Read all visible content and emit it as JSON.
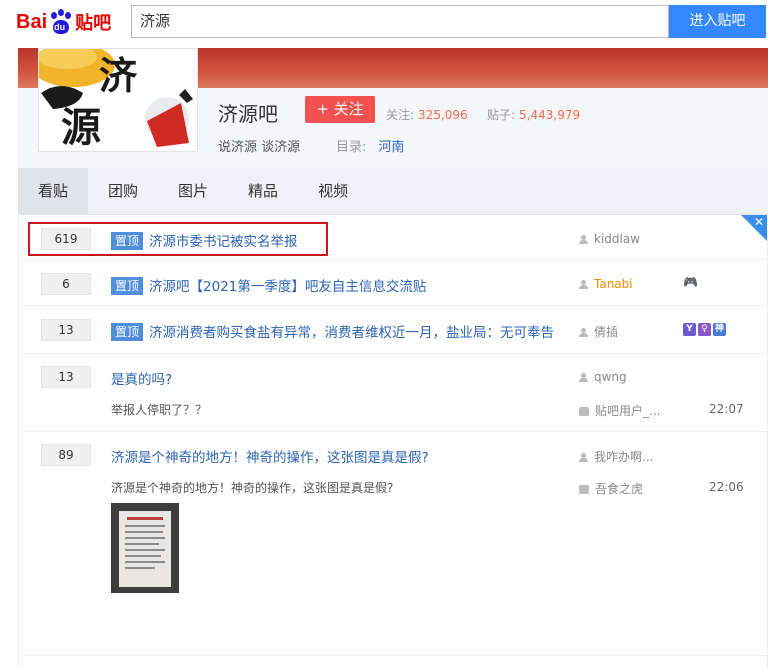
{
  "search": {
    "logo_bai": "Bai",
    "logo_du": "du",
    "logo_tieba": "贴吧",
    "query": "济源",
    "button_label": "进入贴吧"
  },
  "forum": {
    "name": "济源吧",
    "follow_label": "+ 关注",
    "follow_count_label": "关注:",
    "follow_count": "325,096",
    "post_count_label": "贴子:",
    "post_count": "5,443,979",
    "slogan": "说济源 谈济源",
    "catalog_label": "目录:",
    "catalog_value": "河南",
    "avatar_chars": [
      "济",
      "源"
    ]
  },
  "tabs": [
    "看贴",
    "团购",
    "图片",
    "精品",
    "视频"
  ],
  "close_glyph": "✕",
  "threads": [
    {
      "count": "619",
      "pinned": "置顶",
      "title": "济源市委书记被实名举报",
      "author": "kiddlaw"
    },
    {
      "count": "6",
      "pinned": "置顶",
      "title": "济源吧【2021第一季度】吧友自主信息交流贴",
      "author": "Tanabi",
      "author_badge": "🎮"
    },
    {
      "count": "13",
      "pinned": "置顶",
      "title": "济源消费者购买食盐有异常，消费者维权近一月，盐业局：无可奉告",
      "author": "倩插",
      "badges": [
        "Y",
        "♀",
        "神"
      ]
    },
    {
      "count": "13",
      "title": "是真的吗?",
      "author": "qwng",
      "abstract": "举报人停职了？？",
      "reply_author": "贴吧用户_...",
      "time": "22:07"
    },
    {
      "count": "89",
      "title": "济源是个神奇的地方！神奇的操作，这张图是真是假?",
      "author": "我咋办啊...",
      "abstract": "济源是个神奇的地方！神奇的操作，这张图是真是假?",
      "reply_author": "吾食之虎",
      "time": "22:06"
    }
  ],
  "colors": {
    "brand_red": "#e10602",
    "brand_blue": "#2319dc",
    "link_blue": "#2d64b3",
    "pin_blue": "#4f8ddd",
    "follow_red": "#f35050",
    "stat_orange": "#f36a46"
  }
}
